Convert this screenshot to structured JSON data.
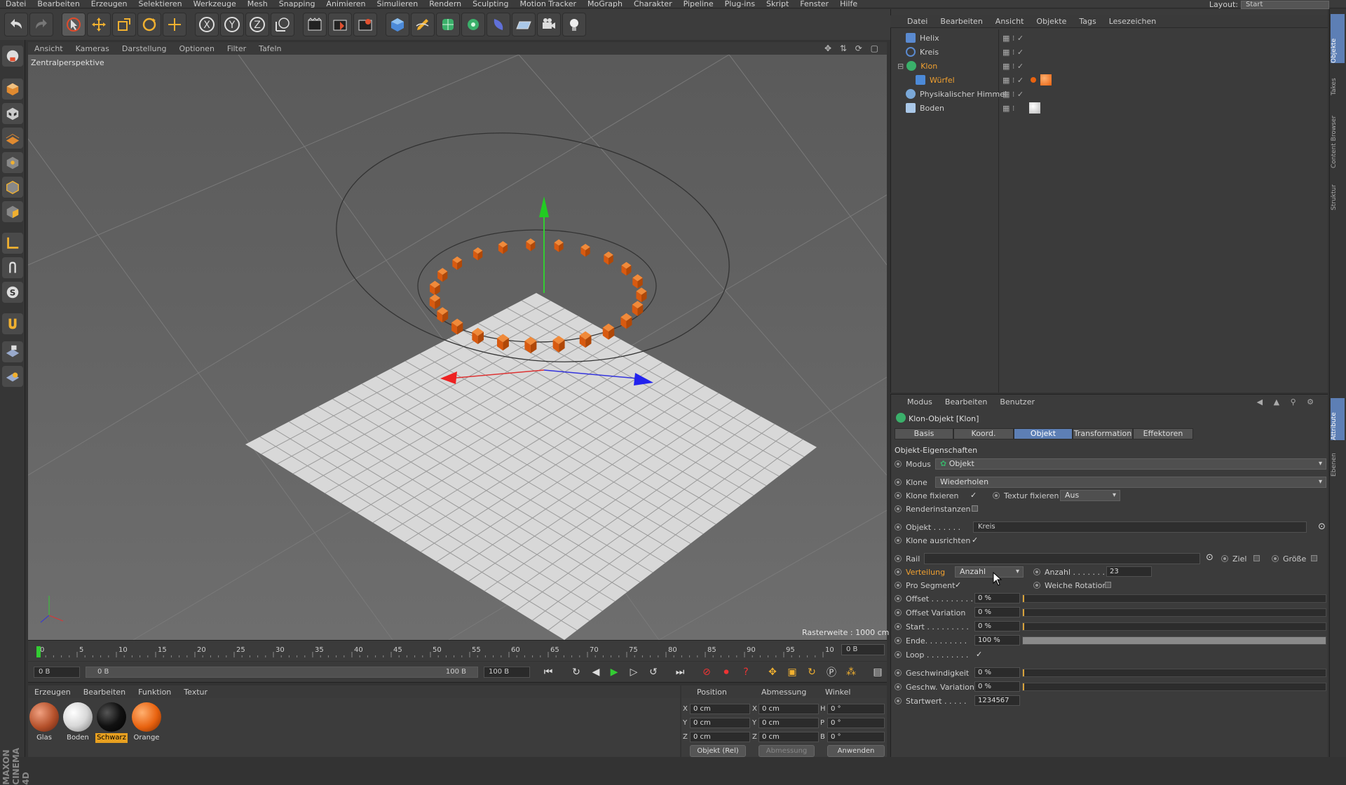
{
  "menubar": {
    "items": [
      "Datei",
      "Bearbeiten",
      "Erzeugen",
      "Selektieren",
      "Werkzeuge",
      "Mesh",
      "Snapping",
      "Animieren",
      "Simulieren",
      "Rendern",
      "Sculpting",
      "Motion Tracker",
      "MoGraph",
      "Charakter",
      "Pipeline",
      "Plug-ins",
      "Skript",
      "Fenster",
      "Hilfe"
    ],
    "layout_label": "Layout:",
    "layout_value": "Start"
  },
  "toolbar": {
    "icons": [
      "undo-icon",
      "redo-icon",
      "select-icon",
      "move-icon",
      "scale-icon",
      "rotate-icon",
      "add-icon",
      "x-axis-icon",
      "y-axis-icon",
      "z-axis-icon",
      "coordinate-system-icon",
      "render-view-icon",
      "render-picture-icon",
      "render-settings-icon",
      "cube-icon",
      "pen-icon",
      "subdivision-icon",
      "cloner-icon",
      "deformer-icon",
      "floor-icon",
      "camera-icon",
      "light-icon"
    ],
    "axis_x": "X",
    "axis_y": "Y",
    "axis_z": "Z"
  },
  "viewport": {
    "menu": [
      "Ansicht",
      "Kameras",
      "Darstellung",
      "Optionen",
      "Filter",
      "Tafeln"
    ],
    "label": "Zentralperspektive",
    "raster": "Rasterweite : 1000 cm"
  },
  "timeline": {
    "ticks": [
      "0",
      "5",
      "10",
      "15",
      "20",
      "25",
      "30",
      "35",
      "40",
      "45",
      "50",
      "55",
      "60",
      "65",
      "70",
      "75",
      "80",
      "85",
      "90",
      "95",
      "100"
    ],
    "end_frame": "0 B",
    "start_field": "0 B",
    "range_start": "0 B",
    "range_end": "100 B",
    "end_field": "100 B"
  },
  "materials": {
    "menu": [
      "Erzeugen",
      "Bearbeiten",
      "Funktion",
      "Textur"
    ],
    "items": [
      {
        "label": "Glas",
        "color": "#b4502a"
      },
      {
        "label": "Boden",
        "color": "#e0e0e0"
      },
      {
        "label": "Schwarz",
        "color": "#111111"
      },
      {
        "label": "Orange",
        "color": "#e8620f"
      }
    ]
  },
  "coordinates": {
    "headers": [
      "Position",
      "Abmessung",
      "Winkel"
    ],
    "rows": [
      {
        "axis": "X",
        "pos": "0 cm",
        "size_axis": "X",
        "size": "0 cm",
        "angle_axis": "H",
        "angle": "0 °"
      },
      {
        "axis": "Y",
        "pos": "0 cm",
        "size_axis": "Y",
        "size": "0 cm",
        "angle_axis": "P",
        "angle": "0 °"
      },
      {
        "axis": "Z",
        "pos": "0 cm",
        "size_axis": "Z",
        "size": "0 cm",
        "angle_axis": "B",
        "angle": "0 °"
      }
    ],
    "mode": "Objekt (Rel)",
    "size_mode": "Abmessung",
    "apply": "Anwenden"
  },
  "objects": {
    "menu": [
      "Datei",
      "Bearbeiten",
      "Ansicht",
      "Objekte",
      "Tags",
      "Lesezeichen"
    ],
    "items": [
      {
        "name": "Helix",
        "color": "#c8c8c8"
      },
      {
        "name": "Kreis",
        "color": "#c8c8c8"
      },
      {
        "name": "Klon",
        "color": "#f0a030"
      },
      {
        "name": "Würfel",
        "color": "#f0a030"
      },
      {
        "name": "Physikalischer Himmel",
        "color": "#c8c8c8"
      },
      {
        "name": "Boden",
        "color": "#c8c8c8"
      }
    ]
  },
  "attributes": {
    "menu": [
      "Modus",
      "Bearbeiten",
      "Benutzer"
    ],
    "title": "Klon-Objekt [Klon]",
    "tabs": [
      "Basis",
      "Koord.",
      "Objekt",
      "Transformation",
      "Effektoren"
    ],
    "active_tab": "Objekt",
    "section": "Objekt-Eigenschaften",
    "modus_label": "Modus",
    "modus_value": "Objekt",
    "klone_label": "Klone",
    "klone_value": "Wiederholen",
    "klone_fixieren": "Klone fixieren",
    "textur_fixieren": "Textur fixieren",
    "textur_value": "Aus",
    "renderinstanzen": "Renderinstanzen",
    "objekt_label": "Objekt . . . . . .",
    "objekt_value": "Kreis",
    "klone_ausrichten": "Klone ausrichten",
    "rail_label": "Rail",
    "ziel_label": "Ziel",
    "groesse_label": "Größe",
    "verteilung_label": "Verteilung",
    "verteilung_value": "Anzahl",
    "anzahl_label": "Anzahl . . . . . . .",
    "anzahl_value": "23",
    "pro_segment": "Pro Segment",
    "weiche_rotation": "Weiche Rotation",
    "offset_label": "Offset . . . . . . . . .",
    "offset_value": "0 %",
    "offset_var_label": "Offset Variation",
    "offset_var_value": "0 %",
    "start_label": "Start . . . . . . . . .",
    "start_value": "0 %",
    "ende_label": "Ende. . . . . . . . .",
    "ende_value": "100 %",
    "ende_fraction": 1.0,
    "loop_label": "Loop . . . . . . . . .",
    "geschw_label": "Geschwindigkeit",
    "geschw_value": "0 %",
    "geschw_var_label": "Geschw. Variation",
    "geschw_var_value": "0 %",
    "startwert_label": "Startwert . . . . .",
    "startwert_value": "1234567"
  },
  "right_tabs": [
    "Objekte",
    "Takes",
    "Content Browser",
    "Struktur",
    "Attribute",
    "Ebenen"
  ],
  "logo": "MAXON CINEMA 4D"
}
